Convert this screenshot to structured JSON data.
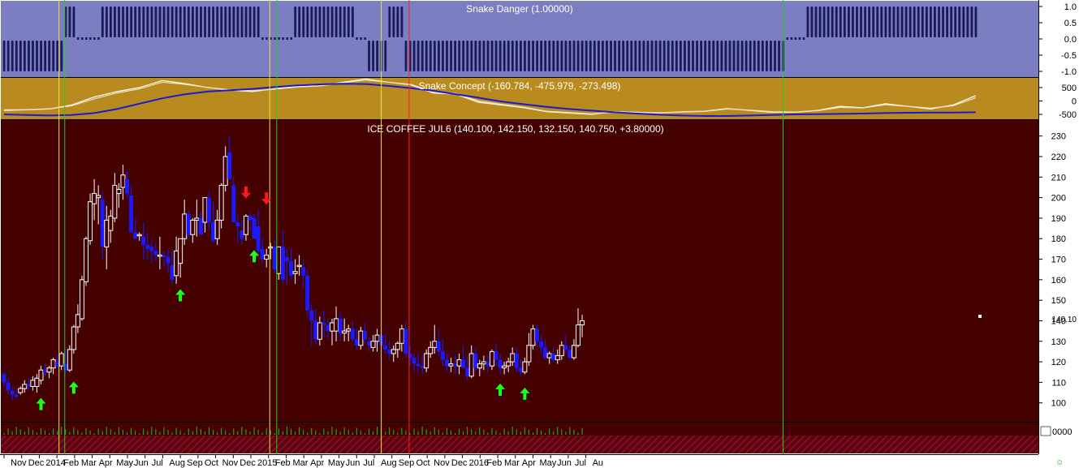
{
  "colors": {
    "danger_bg": "#7b7fc2",
    "concept_bg": "#b98a1e",
    "price_bg": "#450000",
    "bull_candle": "#ffffff",
    "bear_candle": "#1a1aff",
    "danger_bar": "#1a1a5a",
    "axis_bg": "#ffffff",
    "grid_text": "#000000",
    "up_arrow": "#19ff19",
    "down_arrow": "#ff1a1a",
    "vline_green": "#22cc22",
    "vline_yellow": "#e8e83a",
    "vline_red": "#ff2020",
    "volume": "#18c018",
    "hatch": "#b01030"
  },
  "chart_data": [
    {
      "panel": "snake-danger",
      "type": "bar",
      "title": "Snake Danger (1.00000)",
      "y_ticks": [
        "1.0",
        "0.5",
        "0.0",
        "-0.5",
        "-1.0"
      ],
      "ylim": [
        -1.2,
        1.2
      ],
      "segments": [
        {
          "from_week": 0,
          "to_week": 14,
          "value": -1
        },
        {
          "from_week": 15,
          "to_week": 17,
          "value": 1
        },
        {
          "from_week": 18,
          "to_week": 23,
          "value": 0
        },
        {
          "from_week": 24,
          "to_week": 62,
          "value": 1
        },
        {
          "from_week": 63,
          "to_week": 70,
          "value": 0
        },
        {
          "from_week": 71,
          "to_week": 85,
          "value": 1
        },
        {
          "from_week": 86,
          "to_week": 88,
          "value": 0
        },
        {
          "from_week": 89,
          "to_week": 93,
          "value": -1
        },
        {
          "from_week": 94,
          "to_week": 97,
          "value": 1
        },
        {
          "from_week": 98,
          "to_week": 190,
          "value": -1
        },
        {
          "from_week": 191,
          "to_week": 195,
          "value": 0
        },
        {
          "from_week": 196,
          "to_week": 237,
          "value": 1
        }
      ]
    },
    {
      "panel": "snake-concept",
      "type": "line",
      "title": "Snake Concept (-160.784, -475.979, -273.498)",
      "y_ticks": [
        "500",
        "0",
        "-500"
      ],
      "ylim": [
        -650,
        800
      ],
      "series": [
        {
          "role": "fast",
          "color": "#ffffff",
          "values": [
            -350,
            -330,
            -300,
            -150,
            150,
            350,
            500,
            760,
            650,
            500,
            400,
            350,
            460,
            550,
            560,
            700,
            820,
            700,
            600,
            300,
            250,
            -50,
            -150,
            -250,
            -400,
            -450,
            -500,
            -400,
            -420,
            -450,
            -400,
            -380,
            -280,
            -350,
            -420,
            -420,
            -350,
            -200,
            -250,
            -100,
            -200,
            -300,
            -150,
            200
          ]
        },
        {
          "role": "signal",
          "color": "#f0e0c0",
          "values": [
            -330,
            -320,
            -290,
            -180,
            80,
            300,
            450,
            700,
            620,
            500,
            420,
            380,
            440,
            520,
            560,
            680,
            780,
            700,
            620,
            340,
            280,
            0,
            -120,
            -230,
            -380,
            -430,
            -480,
            -420,
            -420,
            -440,
            -410,
            -390,
            -300,
            -340,
            -400,
            -410,
            -360,
            -240,
            -260,
            -140,
            -200,
            -270,
            -180,
            120
          ]
        },
        {
          "role": "slow",
          "color": "#1a1ad0",
          "values": [
            -500,
            -520,
            -540,
            -520,
            -450,
            -300,
            -100,
            100,
            250,
            350,
            400,
            450,
            520,
            580,
            620,
            640,
            630,
            560,
            480,
            380,
            250,
            120,
            -20,
            -120,
            -220,
            -300,
            -360,
            -420,
            -470,
            -510,
            -540,
            -560,
            -560,
            -540,
            -520,
            -500,
            -490,
            -480,
            -470,
            -450,
            -440,
            -430,
            -430,
            -420
          ]
        }
      ]
    },
    {
      "panel": "price",
      "type": "candlestick",
      "title": "ICE COFFEE JUL6 (140.100, 142.150, 132.150, 140.750, +3.80000)",
      "y_ticks": [
        "230",
        "220",
        "210",
        "200",
        "190",
        "180",
        "170",
        "160",
        "150",
        "140",
        "130",
        "120",
        "110",
        "100"
      ],
      "ylim": [
        90,
        237
      ],
      "x_ticks": [
        "Nov",
        "Dec",
        "2014",
        "Feb",
        "Mar",
        "Apr",
        "May",
        "Jun",
        "Jul",
        "Aug",
        "Sep",
        "Oct",
        "Nov",
        "Dec",
        "2015",
        "Feb",
        "Mar",
        "Apr",
        "May",
        "Jun",
        "Jul",
        "Aug",
        "Sep",
        "Oct",
        "Nov",
        "Dec",
        "2016",
        "Feb",
        "Mar",
        "Apr",
        "May",
        "Jun",
        "Jul",
        "Au"
      ],
      "weeks_per_tick_month": 4.3,
      "ohlc": [
        [
          114,
          115,
          108,
          110
        ],
        [
          110,
          112,
          104,
          106
        ],
        [
          106,
          108,
          101,
          104
        ],
        [
          104,
          107,
          102,
          103
        ],
        [
          105,
          108,
          104,
          107
        ],
        [
          107,
          111,
          105,
          109
        ],
        [
          109,
          112,
          106,
          108
        ],
        [
          108,
          113,
          106,
          111
        ],
        [
          108,
          114,
          105,
          112
        ],
        [
          111,
          118,
          109,
          116
        ],
        [
          116,
          119,
          113,
          115
        ],
        [
          115,
          118,
          112,
          117
        ],
        [
          117,
          122,
          114,
          121
        ],
        [
          120,
          124,
          117,
          118
        ],
        [
          118,
          125,
          116,
          124
        ],
        [
          119,
          126,
          114,
          116
        ],
        [
          116,
          128,
          115,
          126
        ],
        [
          126,
          138,
          124,
          137
        ],
        [
          137,
          148,
          134,
          143
        ],
        [
          141,
          162,
          140,
          160
        ],
        [
          159,
          181,
          157,
          180
        ],
        [
          179,
          202,
          177,
          198
        ],
        [
          197,
          209,
          189,
          202
        ],
        [
          200,
          206,
          187,
          201
        ],
        [
          199,
          203,
          170,
          176
        ],
        [
          176,
          196,
          165,
          189
        ],
        [
          184,
          194,
          178,
          191
        ],
        [
          190,
          212,
          188,
          206
        ],
        [
          202,
          207,
          195,
          204
        ],
        [
          205,
          216,
          199,
          211
        ],
        [
          209,
          213,
          200,
          202
        ],
        [
          201,
          206,
          196,
          183
        ],
        [
          183,
          190,
          180,
          180
        ],
        [
          182,
          183,
          179,
          182
        ],
        [
          181,
          188,
          170,
          177
        ],
        [
          177,
          183,
          170,
          175
        ],
        [
          176,
          179,
          168,
          174
        ],
        [
          174,
          178,
          169,
          172
        ],
        [
          172,
          181,
          165,
          172
        ],
        [
          172,
          174,
          166,
          171
        ],
        [
          171,
          175,
          163,
          168
        ],
        [
          167,
          174,
          158,
          160
        ],
        [
          162,
          181,
          158,
          174
        ],
        [
          168,
          176,
          161,
          180
        ],
        [
          180,
          199,
          177,
          192
        ],
        [
          192,
          194,
          180,
          182
        ],
        [
          182,
          190,
          178,
          189
        ],
        [
          189,
          199,
          181,
          190
        ],
        [
          190,
          193,
          182,
          182
        ],
        [
          188,
          199,
          183,
          200
        ],
        [
          200,
          203,
          184,
          188
        ],
        [
          188,
          198,
          178,
          179
        ],
        [
          180,
          194,
          177,
          189
        ],
        [
          189,
          207,
          185,
          206
        ],
        [
          206,
          225,
          203,
          220
        ],
        [
          222,
          230,
          211,
          209
        ],
        [
          206,
          210,
          188,
          188
        ],
        [
          188,
          192,
          178,
          186
        ],
        [
          184,
          189,
          177,
          180
        ],
        [
          182,
          192,
          179,
          191
        ],
        [
          191,
          193,
          183,
          189
        ],
        [
          190,
          192,
          180,
          180
        ],
        [
          186,
          194,
          172,
          174
        ],
        [
          175,
          180,
          168,
          170
        ],
        [
          170,
          175,
          166,
          172
        ],
        [
          176,
          178,
          170,
          176
        ],
        [
          176,
          179,
          163,
          165
        ],
        [
          163,
          175,
          160,
          176
        ],
        [
          176,
          184,
          158,
          160
        ],
        [
          171,
          175,
          158,
          169
        ],
        [
          169,
          175,
          160,
          162
        ],
        [
          163,
          170,
          158,
          164
        ],
        [
          167,
          172,
          162,
          167
        ],
        [
          166,
          170,
          156,
          162
        ],
        [
          162,
          165,
          142,
          145
        ],
        [
          145,
          148,
          128,
          140
        ],
        [
          140,
          146,
          128,
          131
        ],
        [
          131,
          142,
          128,
          139
        ],
        [
          139,
          145,
          132,
          138
        ],
        [
          138,
          141,
          131,
          135
        ],
        [
          135,
          141,
          128,
          139
        ],
        [
          135,
          147,
          130,
          141
        ],
        [
          141,
          144,
          130,
          134
        ],
        [
          134,
          141,
          130,
          135
        ],
        [
          135,
          138,
          130,
          136
        ],
        [
          136,
          140,
          130,
          131
        ],
        [
          131,
          136,
          126,
          128
        ],
        [
          128,
          137,
          126,
          135
        ],
        [
          135,
          139,
          129,
          131
        ],
        [
          130,
          132,
          125,
          128
        ],
        [
          127,
          133,
          125,
          130
        ],
        [
          130,
          136,
          125,
          133
        ],
        [
          133,
          135,
          126,
          128
        ],
        [
          128,
          134,
          124,
          126
        ],
        [
          126,
          130,
          121,
          124
        ],
        [
          124,
          128,
          120,
          126
        ],
        [
          126,
          130,
          122,
          129
        ],
        [
          129,
          138,
          125,
          136
        ],
        [
          136,
          140,
          122,
          124
        ],
        [
          124,
          128,
          118,
          122
        ],
        [
          122,
          124,
          115,
          119
        ],
        [
          119,
          124,
          115,
          118
        ],
        [
          118,
          123,
          114,
          117
        ],
        [
          117,
          126,
          115,
          124
        ],
        [
          124,
          130,
          122,
          127
        ],
        [
          127,
          138,
          124,
          130
        ],
        [
          130,
          136,
          123,
          125
        ],
        [
          125,
          131,
          118,
          121
        ],
        [
          121,
          124,
          115,
          118
        ],
        [
          118,
          122,
          115,
          119
        ],
        [
          119,
          123,
          114,
          118
        ],
        [
          118,
          124,
          114,
          121
        ],
        [
          121,
          128,
          117,
          117
        ],
        [
          117,
          123,
          111,
          113
        ],
        [
          113,
          128,
          112,
          124
        ],
        [
          124,
          127,
          115,
          117
        ],
        [
          117,
          121,
          113,
          119
        ],
        [
          119,
          123,
          116,
          120
        ],
        [
          120,
          123,
          115,
          118
        ],
        [
          118,
          126,
          116,
          125
        ],
        [
          125,
          129,
          118,
          121
        ],
        [
          121,
          124,
          114,
          117
        ],
        [
          117,
          120,
          114,
          118
        ],
        [
          118,
          122,
          115,
          120
        ],
        [
          120,
          127,
          118,
          124
        ],
        [
          124,
          127,
          115,
          117
        ],
        [
          117,
          121,
          113,
          115
        ],
        [
          115,
          122,
          114,
          120
        ],
        [
          120,
          134,
          118,
          128
        ],
        [
          128,
          138,
          126,
          136
        ],
        [
          136,
          138,
          127,
          130
        ],
        [
          130,
          133,
          124,
          127
        ],
        [
          127,
          131,
          121,
          122
        ],
        [
          122,
          125,
          119,
          124
        ],
        [
          124,
          127,
          120,
          121
        ],
        [
          121,
          126,
          119,
          123
        ],
        [
          123,
          130,
          121,
          128
        ],
        [
          128,
          133,
          124,
          126
        ],
        [
          126,
          128,
          121,
          122
        ],
        [
          122,
          131,
          121,
          128
        ],
        [
          128,
          146,
          127,
          138
        ],
        [
          138,
          143,
          132,
          140
        ]
      ],
      "annotations": [
        {
          "kind": "up-arrow",
          "week": 9,
          "price": 104
        },
        {
          "kind": "up-arrow",
          "week": 17,
          "price": 112
        },
        {
          "kind": "up-arrow",
          "week": 43,
          "price": 157
        },
        {
          "kind": "up-arrow",
          "week": 61,
          "price": 176
        },
        {
          "kind": "up-arrow",
          "week": 121,
          "price": 111
        },
        {
          "kind": "up-arrow",
          "week": 127,
          "price": 109
        },
        {
          "kind": "down-arrow",
          "week": 59,
          "price": 198
        },
        {
          "kind": "down-arrow",
          "week": 64,
          "price": 195
        }
      ]
    }
  ],
  "last_price_label": "140.10",
  "volume_axis_label": "0000"
}
